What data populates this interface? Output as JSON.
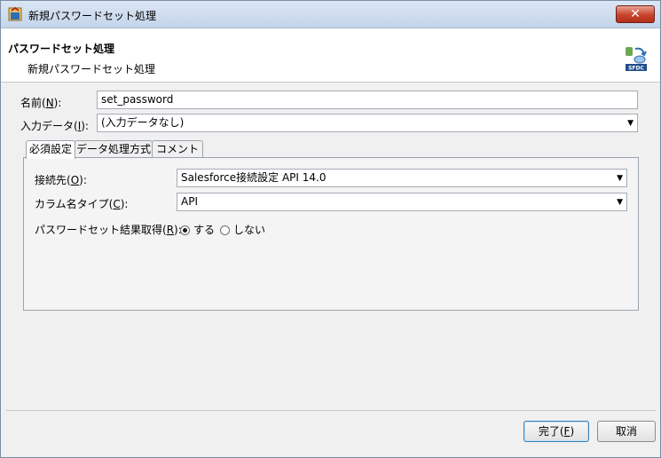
{
  "window": {
    "title": "新規パスワードセット処理",
    "close_label": "✕"
  },
  "header": {
    "title": "パスワードセット処理",
    "subtitle": "新規パスワードセット処理"
  },
  "form": {
    "name": {
      "label_pre": "名前(",
      "key": "N",
      "label_post": "):",
      "value": "set_password"
    },
    "input_data": {
      "label_pre": "入力データ(",
      "key": "I",
      "label_post": "):",
      "value": "(入力データなし)"
    }
  },
  "tabs": [
    {
      "label": "必須設定"
    },
    {
      "label": "データ処理方式"
    },
    {
      "label": "コメント"
    }
  ],
  "required": {
    "connection": {
      "label_pre": "接続先(",
      "key": "O",
      "label_post": "):",
      "value": "Salesforce接続設定 API 14.0"
    },
    "column_type": {
      "label_pre": "カラム名タイプ(",
      "key": "C",
      "label_post": "):",
      "value": "API"
    },
    "result": {
      "label_pre": "パスワードセット結果取得(",
      "key": "R",
      "label_post": "):",
      "option_yes": "する",
      "option_no": "しない",
      "selected": "yes"
    }
  },
  "buttons": {
    "finish": {
      "label_pre": "完了(",
      "key": "F",
      "label_post": ")"
    },
    "cancel": {
      "label": "取消"
    }
  },
  "colors": {
    "accent": "#3c7fb1",
    "close": "#c7432a",
    "titlebar": "#c5d5ea"
  }
}
